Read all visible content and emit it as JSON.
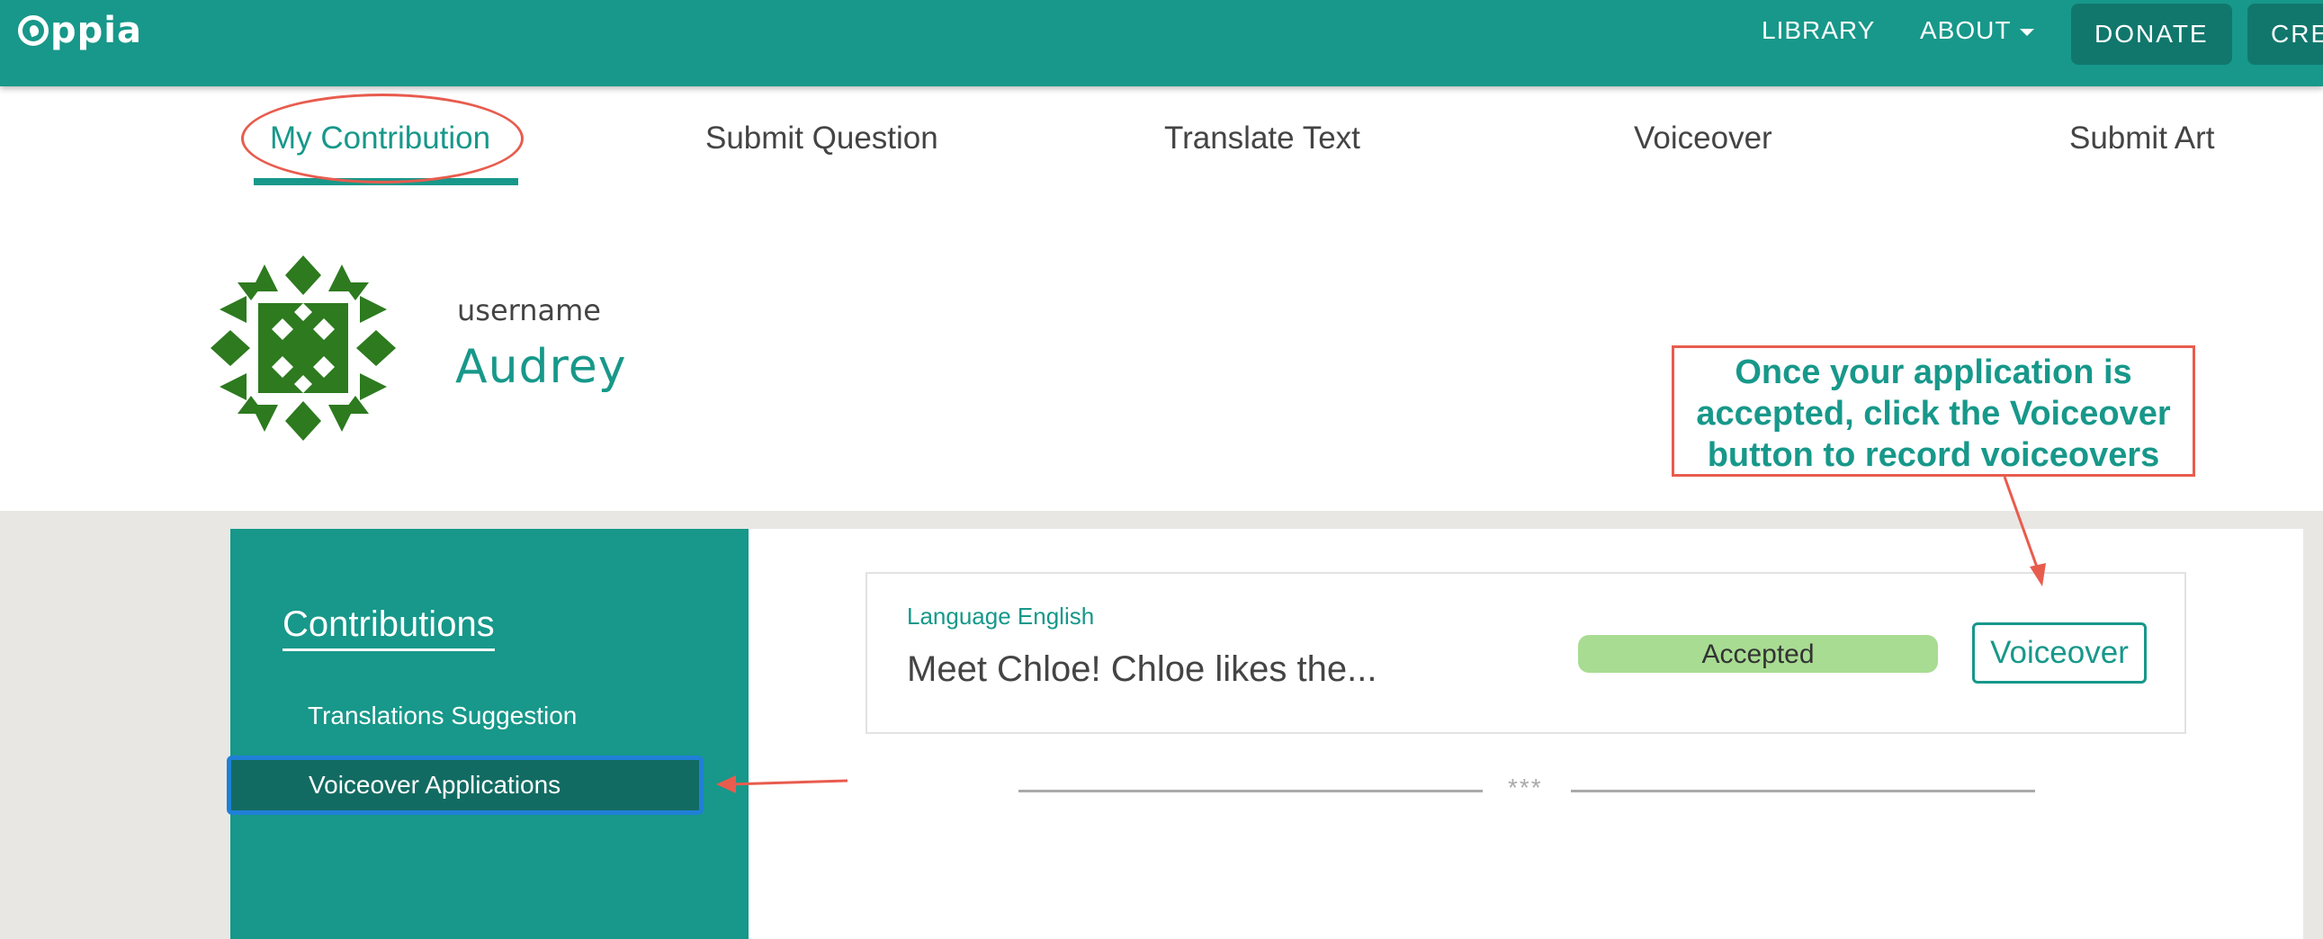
{
  "brand": {
    "name": "ppia",
    "accent": "#17988a",
    "dark_accent": "#11776d",
    "annotation_color": "#e85c4e"
  },
  "topnav": {
    "library": "LIBRARY",
    "about": "ABOUT",
    "donate": "DONATE",
    "create": "CREATE"
  },
  "tabs": [
    {
      "label": "My Contribution",
      "active": true
    },
    {
      "label": "Submit Question"
    },
    {
      "label": "Translate Text"
    },
    {
      "label": "Voiceover"
    },
    {
      "label": "Submit Art"
    }
  ],
  "profile": {
    "username_label": "username",
    "username": "Audrey",
    "avatar_icon": "pattern-avatar-icon"
  },
  "annotation": {
    "text": "Once your application is accepted, click the Voiceover button to record voiceovers"
  },
  "sidebar": {
    "title": "Contributions",
    "items": [
      {
        "label": "Translations Suggestion"
      },
      {
        "label": "Voiceover Applications",
        "active": true
      }
    ]
  },
  "card": {
    "language": "Language English",
    "title": "Meet Chloe! Chloe likes the...",
    "status": "Accepted",
    "status_color": "#a8dc92",
    "button": "Voiceover"
  },
  "divider": {
    "text": "***"
  }
}
